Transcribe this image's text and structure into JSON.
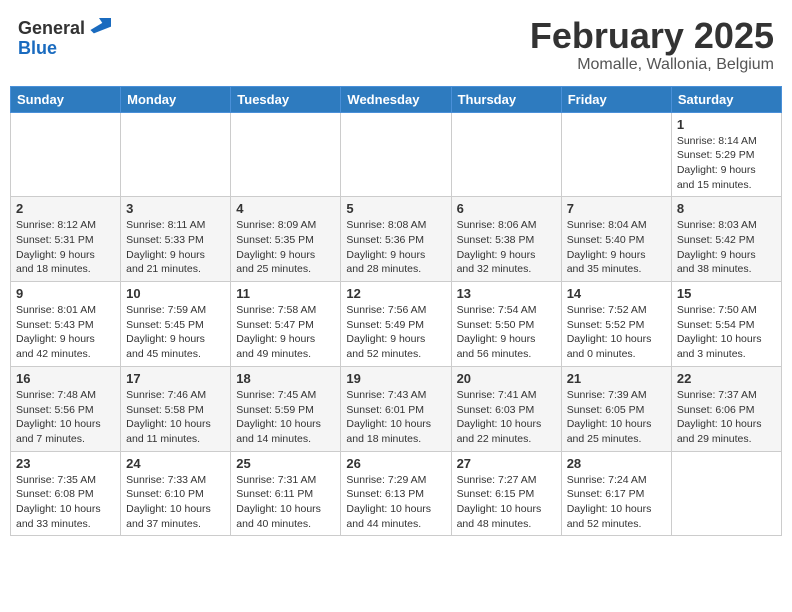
{
  "header": {
    "logo_general": "General",
    "logo_blue": "Blue",
    "month_title": "February 2025",
    "location": "Momalle, Wallonia, Belgium"
  },
  "days_of_week": [
    "Sunday",
    "Monday",
    "Tuesday",
    "Wednesday",
    "Thursday",
    "Friday",
    "Saturday"
  ],
  "weeks": [
    [
      {
        "day": "",
        "info": ""
      },
      {
        "day": "",
        "info": ""
      },
      {
        "day": "",
        "info": ""
      },
      {
        "day": "",
        "info": ""
      },
      {
        "day": "",
        "info": ""
      },
      {
        "day": "",
        "info": ""
      },
      {
        "day": "1",
        "info": "Sunrise: 8:14 AM\nSunset: 5:29 PM\nDaylight: 9 hours and 15 minutes."
      }
    ],
    [
      {
        "day": "2",
        "info": "Sunrise: 8:12 AM\nSunset: 5:31 PM\nDaylight: 9 hours and 18 minutes."
      },
      {
        "day": "3",
        "info": "Sunrise: 8:11 AM\nSunset: 5:33 PM\nDaylight: 9 hours and 21 minutes."
      },
      {
        "day": "4",
        "info": "Sunrise: 8:09 AM\nSunset: 5:35 PM\nDaylight: 9 hours and 25 minutes."
      },
      {
        "day": "5",
        "info": "Sunrise: 8:08 AM\nSunset: 5:36 PM\nDaylight: 9 hours and 28 minutes."
      },
      {
        "day": "6",
        "info": "Sunrise: 8:06 AM\nSunset: 5:38 PM\nDaylight: 9 hours and 32 minutes."
      },
      {
        "day": "7",
        "info": "Sunrise: 8:04 AM\nSunset: 5:40 PM\nDaylight: 9 hours and 35 minutes."
      },
      {
        "day": "8",
        "info": "Sunrise: 8:03 AM\nSunset: 5:42 PM\nDaylight: 9 hours and 38 minutes."
      }
    ],
    [
      {
        "day": "9",
        "info": "Sunrise: 8:01 AM\nSunset: 5:43 PM\nDaylight: 9 hours and 42 minutes."
      },
      {
        "day": "10",
        "info": "Sunrise: 7:59 AM\nSunset: 5:45 PM\nDaylight: 9 hours and 45 minutes."
      },
      {
        "day": "11",
        "info": "Sunrise: 7:58 AM\nSunset: 5:47 PM\nDaylight: 9 hours and 49 minutes."
      },
      {
        "day": "12",
        "info": "Sunrise: 7:56 AM\nSunset: 5:49 PM\nDaylight: 9 hours and 52 minutes."
      },
      {
        "day": "13",
        "info": "Sunrise: 7:54 AM\nSunset: 5:50 PM\nDaylight: 9 hours and 56 minutes."
      },
      {
        "day": "14",
        "info": "Sunrise: 7:52 AM\nSunset: 5:52 PM\nDaylight: 10 hours and 0 minutes."
      },
      {
        "day": "15",
        "info": "Sunrise: 7:50 AM\nSunset: 5:54 PM\nDaylight: 10 hours and 3 minutes."
      }
    ],
    [
      {
        "day": "16",
        "info": "Sunrise: 7:48 AM\nSunset: 5:56 PM\nDaylight: 10 hours and 7 minutes."
      },
      {
        "day": "17",
        "info": "Sunrise: 7:46 AM\nSunset: 5:58 PM\nDaylight: 10 hours and 11 minutes."
      },
      {
        "day": "18",
        "info": "Sunrise: 7:45 AM\nSunset: 5:59 PM\nDaylight: 10 hours and 14 minutes."
      },
      {
        "day": "19",
        "info": "Sunrise: 7:43 AM\nSunset: 6:01 PM\nDaylight: 10 hours and 18 minutes."
      },
      {
        "day": "20",
        "info": "Sunrise: 7:41 AM\nSunset: 6:03 PM\nDaylight: 10 hours and 22 minutes."
      },
      {
        "day": "21",
        "info": "Sunrise: 7:39 AM\nSunset: 6:05 PM\nDaylight: 10 hours and 25 minutes."
      },
      {
        "day": "22",
        "info": "Sunrise: 7:37 AM\nSunset: 6:06 PM\nDaylight: 10 hours and 29 minutes."
      }
    ],
    [
      {
        "day": "23",
        "info": "Sunrise: 7:35 AM\nSunset: 6:08 PM\nDaylight: 10 hours and 33 minutes."
      },
      {
        "day": "24",
        "info": "Sunrise: 7:33 AM\nSunset: 6:10 PM\nDaylight: 10 hours and 37 minutes."
      },
      {
        "day": "25",
        "info": "Sunrise: 7:31 AM\nSunset: 6:11 PM\nDaylight: 10 hours and 40 minutes."
      },
      {
        "day": "26",
        "info": "Sunrise: 7:29 AM\nSunset: 6:13 PM\nDaylight: 10 hours and 44 minutes."
      },
      {
        "day": "27",
        "info": "Sunrise: 7:27 AM\nSunset: 6:15 PM\nDaylight: 10 hours and 48 minutes."
      },
      {
        "day": "28",
        "info": "Sunrise: 7:24 AM\nSunset: 6:17 PM\nDaylight: 10 hours and 52 minutes."
      },
      {
        "day": "",
        "info": ""
      }
    ]
  ]
}
